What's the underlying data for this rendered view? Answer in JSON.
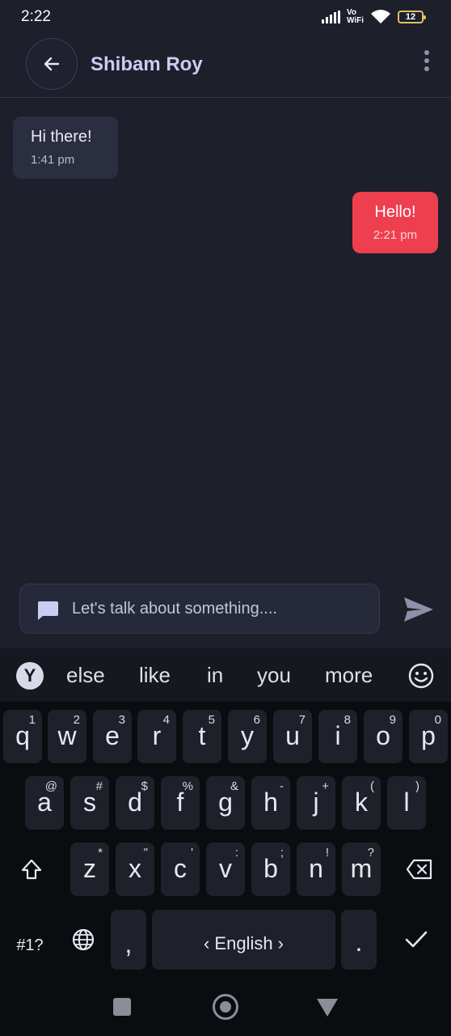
{
  "status_bar": {
    "time": "2:22",
    "network_label_top": "Vo",
    "network_label_bottom": "WiFi",
    "battery": "12"
  },
  "header": {
    "title": "Shibam Roy"
  },
  "messages": [
    {
      "direction": "incoming",
      "text": "Hi there!",
      "time": "1:41 pm"
    },
    {
      "direction": "outgoing",
      "text": "Hello!",
      "time": "2:21 pm"
    }
  ],
  "composer": {
    "placeholder": "Let's talk about something...."
  },
  "keyboard": {
    "suggestions": [
      "else",
      "like",
      "in",
      "you",
      "more"
    ],
    "row1": [
      {
        "key": "q",
        "hint": "1"
      },
      {
        "key": "w",
        "hint": "2"
      },
      {
        "key": "e",
        "hint": "3"
      },
      {
        "key": "r",
        "hint": "4"
      },
      {
        "key": "t",
        "hint": "5"
      },
      {
        "key": "y",
        "hint": "6"
      },
      {
        "key": "u",
        "hint": "7"
      },
      {
        "key": "i",
        "hint": "8"
      },
      {
        "key": "o",
        "hint": "9"
      },
      {
        "key": "p",
        "hint": "0"
      }
    ],
    "row2": [
      {
        "key": "a",
        "hint": "@"
      },
      {
        "key": "s",
        "hint": "#"
      },
      {
        "key": "d",
        "hint": "$"
      },
      {
        "key": "f",
        "hint": "%"
      },
      {
        "key": "g",
        "hint": "&"
      },
      {
        "key": "h",
        "hint": "-"
      },
      {
        "key": "j",
        "hint": "+"
      },
      {
        "key": "k",
        "hint": "("
      },
      {
        "key": "l",
        "hint": ")"
      }
    ],
    "row3": [
      {
        "key": "z",
        "hint": "*"
      },
      {
        "key": "x",
        "hint": "\""
      },
      {
        "key": "c",
        "hint": "'"
      },
      {
        "key": "v",
        "hint": ":"
      },
      {
        "key": "b",
        "hint": ";"
      },
      {
        "key": "n",
        "hint": "!"
      },
      {
        "key": "m",
        "hint": "?"
      }
    ],
    "symbols_key": "#1?",
    "comma_key": ",",
    "space_label": "‹ English ›",
    "period_key": "."
  },
  "colors": {
    "background": "#1d1f2b",
    "outgoing_bubble": "#ee3f4f",
    "incoming_bubble": "#2b2e40",
    "title": "#c9cdf2"
  }
}
